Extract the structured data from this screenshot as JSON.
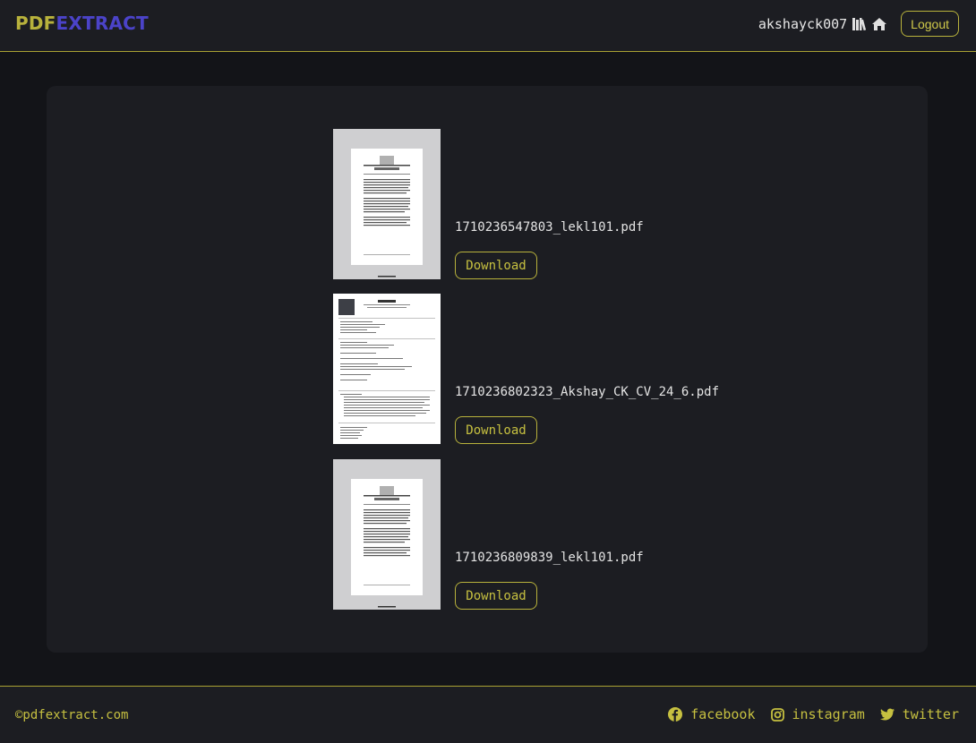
{
  "brand": {
    "part1": "PDF",
    "part2": "EXTRACT"
  },
  "header": {
    "username": "akshayck007",
    "library_icon": "library-icon",
    "home_icon": "home-icon",
    "logout_label": "Logout"
  },
  "files": [
    {
      "filename": "1710236547803_lekl101.pdf",
      "download_label": "Download",
      "thumbnail": "pdf-page-thumbnail"
    },
    {
      "filename": "1710236802323_Akshay_CK_CV_24_6.pdf",
      "download_label": "Download",
      "thumbnail": "pdf-page-thumbnail"
    },
    {
      "filename": "1710236809839_lekl101.pdf",
      "download_label": "Download",
      "thumbnail": "pdf-page-thumbnail"
    }
  ],
  "footer": {
    "copyright": "©pdfextract.com",
    "social": [
      {
        "label": "facebook",
        "icon": "facebook-icon"
      },
      {
        "label": "instagram",
        "icon": "instagram-icon"
      },
      {
        "label": "twitter",
        "icon": "twitter-icon"
      }
    ]
  },
  "colors": {
    "accent": "#b8b23c",
    "brand_secondary": "#4b43c9",
    "background": "#131418",
    "surface": "#1c1d22"
  }
}
